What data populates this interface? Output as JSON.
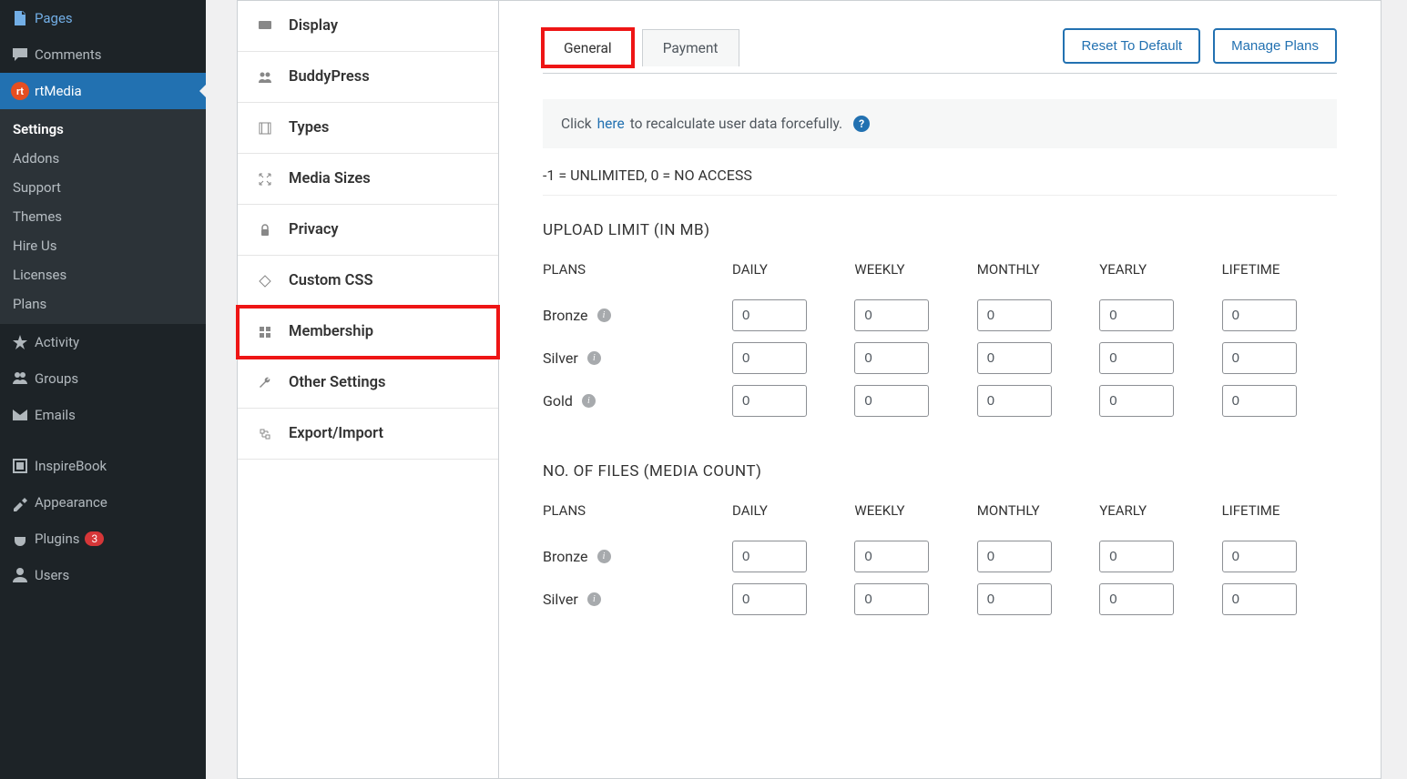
{
  "admin_sidebar": {
    "pages": "Pages",
    "comments": "Comments",
    "rtmedia": "rtMedia",
    "submenu": [
      "Settings",
      "Addons",
      "Support",
      "Themes",
      "Hire Us",
      "Licenses",
      "Plans"
    ],
    "activity": "Activity",
    "groups": "Groups",
    "emails": "Emails",
    "inspirebook": "InspireBook",
    "appearance": "Appearance",
    "plugins": "Plugins",
    "plugins_count": "3",
    "users": "Users"
  },
  "side_tabs": [
    "Display",
    "BuddyPress",
    "Types",
    "Media Sizes",
    "Privacy",
    "Custom CSS",
    "Membership",
    "Other Settings",
    "Export/Import"
  ],
  "top": {
    "tab_general": "General",
    "tab_payment": "Payment",
    "reset": "Reset To Default",
    "manage": "Manage Plans"
  },
  "notice": {
    "pre": "Click ",
    "link": "here",
    "post": " to recalculate user data forcefully."
  },
  "legend": "-1 = UNLIMITED, 0 = NO ACCESS",
  "columns": [
    "DAILY",
    "WEEKLY",
    "MONTHLY",
    "YEARLY",
    "LIFETIME"
  ],
  "plans_label": "PLANS",
  "section1": {
    "title": "UPLOAD LIMIT (IN MB)",
    "rows": [
      {
        "name": "Bronze",
        "vals": [
          "0",
          "0",
          "0",
          "0",
          "0"
        ]
      },
      {
        "name": "Silver",
        "vals": [
          "0",
          "0",
          "0",
          "0",
          "0"
        ]
      },
      {
        "name": "Gold",
        "vals": [
          "0",
          "0",
          "0",
          "0",
          "0"
        ]
      }
    ]
  },
  "section2": {
    "title": "NO. OF FILES (MEDIA COUNT)",
    "rows": [
      {
        "name": "Bronze",
        "vals": [
          "0",
          "0",
          "0",
          "0",
          "0"
        ]
      },
      {
        "name": "Silver",
        "vals": [
          "0",
          "0",
          "0",
          "0",
          "0"
        ]
      }
    ]
  }
}
